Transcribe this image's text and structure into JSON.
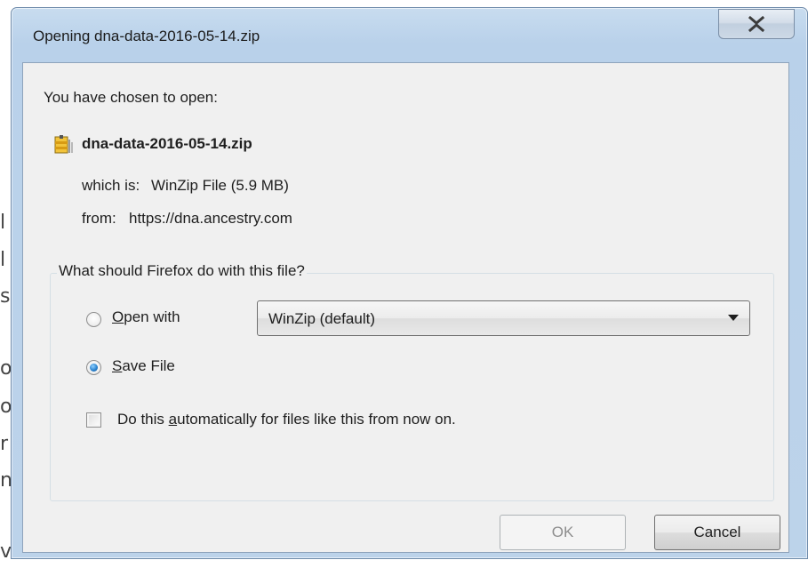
{
  "window": {
    "title": "Opening dna-data-2016-05-14.zip",
    "close_label": "X"
  },
  "dialog": {
    "intro": "You have chosen to open:",
    "file_name": "dna-data-2016-05-14.zip",
    "which_is_label": "which is:",
    "which_is_value": "WinZip File (5.9 MB)",
    "from_label": "from:",
    "from_value": "https://dna.ancestry.com",
    "question": "What should Firefox do with this file?",
    "open_with": {
      "mnemonic": "O",
      "label_rest": "pen with",
      "checked": false,
      "app_selected": "WinZip (default)"
    },
    "save_file": {
      "mnemonic": "S",
      "label_rest": "ave File",
      "checked": true
    },
    "auto": {
      "label_before": "Do this ",
      "mnemonic": "a",
      "label_after": "utomatically for files like this from now on.",
      "checked": false
    },
    "buttons": {
      "ok": "OK",
      "cancel": "Cancel"
    }
  },
  "background_page": {
    "edge_chars": [
      "l",
      "l",
      "s",
      "o",
      "o",
      "r",
      "n",
      "v"
    ]
  },
  "colors": {
    "titlebar": "#b9d1ea",
    "client_bg": "#f0f0f0",
    "radio_selected": "#2b83cf"
  },
  "icons": {
    "file_icon": "winzip-archive-icon",
    "close": "close-x-icon"
  }
}
